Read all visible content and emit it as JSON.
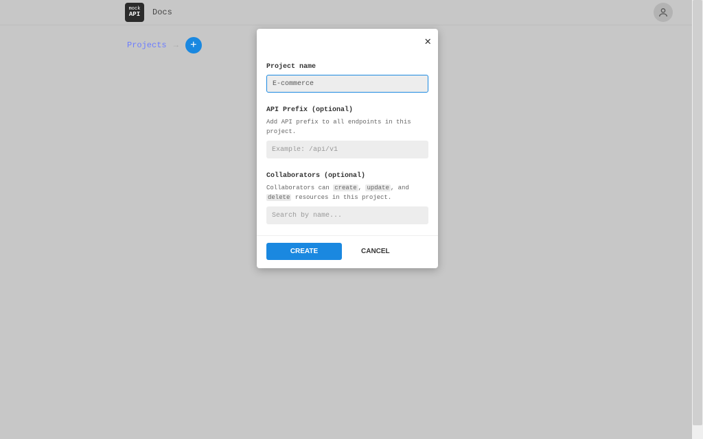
{
  "header": {
    "logo_top": "mock",
    "logo_bottom": "API",
    "docs_label": "Docs"
  },
  "breadcrumb": {
    "projects_label": "Projects"
  },
  "modal": {
    "close_glyph": "✕",
    "project_name_label": "Project name",
    "project_name_value": "E-commerce",
    "api_prefix_label": "API Prefix (optional)",
    "api_prefix_help": "Add API prefix to all endpoints in this project.",
    "api_prefix_placeholder": "Example: /api/v1",
    "collaborators_label": "Collaborators (optional)",
    "collab_help_prefix": "Collaborators can ",
    "collab_kw_create": "create",
    "collab_sep1": ", ",
    "collab_kw_update": "update",
    "collab_sep2": ", and ",
    "collab_kw_delete": "delete",
    "collab_help_suffix": " resources in this project.",
    "collaborators_placeholder": "Search by name...",
    "create_label": "CREATE",
    "cancel_label": "CANCEL"
  }
}
